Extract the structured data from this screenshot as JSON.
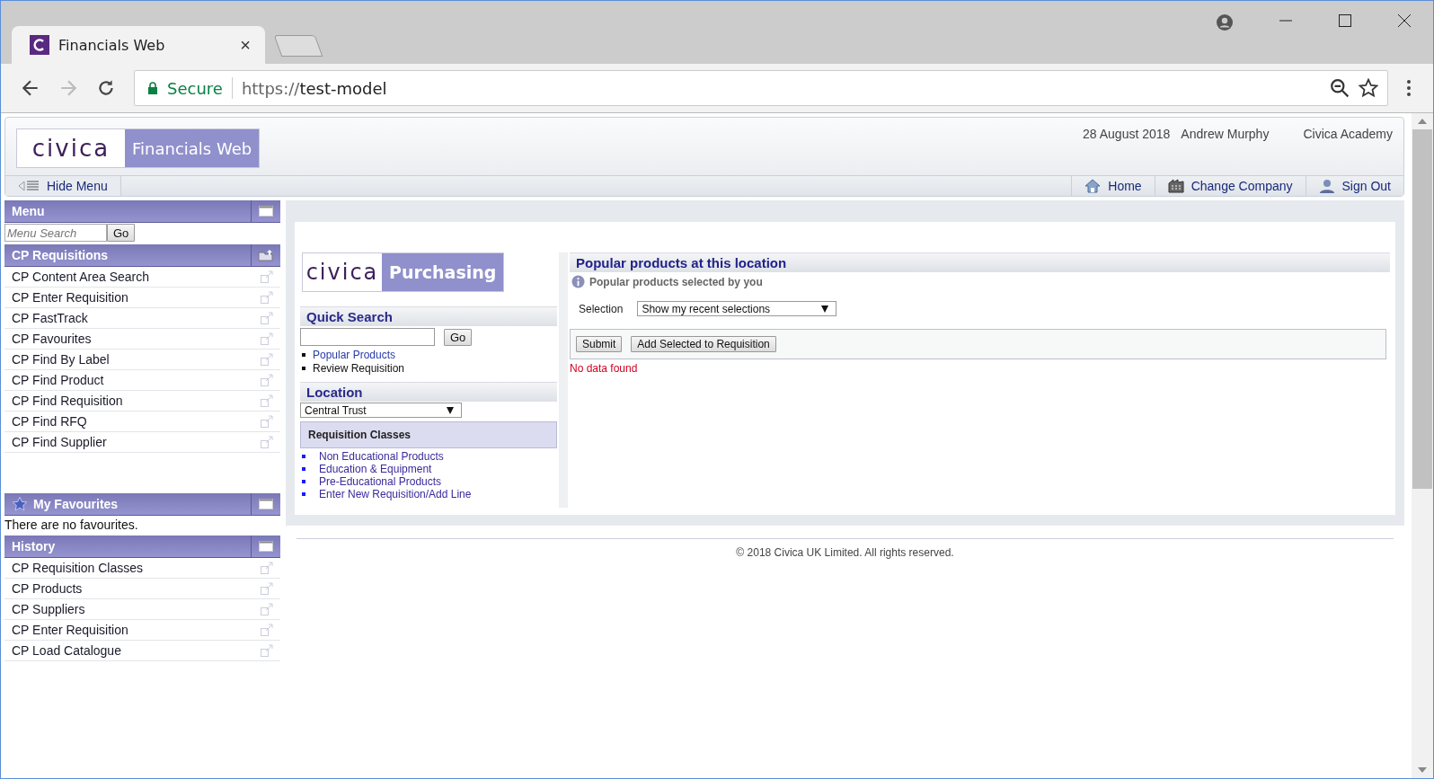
{
  "browser": {
    "tab_title": "Financials Web",
    "tab_close": "×",
    "secure_label": "Secure",
    "url_scheme": "https://",
    "url_host": "test-model"
  },
  "header": {
    "logo_text": "civica",
    "product": "Financials Web",
    "date": "28 August 2018",
    "user": "Andrew Murphy",
    "organisation": "Civica Academy"
  },
  "nav": {
    "hide_menu": "Hide Menu",
    "links": [
      {
        "kind": "home",
        "label": "Home"
      },
      {
        "kind": "company",
        "label": "Change Company"
      },
      {
        "kind": "signout",
        "label": "Sign Out"
      }
    ]
  },
  "sidebar": {
    "menu_title": "Menu",
    "search_placeholder": "Menu Search",
    "search_button": "Go",
    "sections": [
      {
        "kind": "list",
        "title": "CP Requisitions",
        "items": [
          "CP Content Area Search",
          "CP Enter Requisition",
          "CP FastTrack",
          "CP Favourites",
          "CP Find By Label",
          "CP Find Product",
          "CP Find Requisition",
          "CP Find RFQ",
          "CP Find Supplier"
        ]
      },
      {
        "kind": "favourites",
        "title": "My Favourites",
        "empty_text": "There are no favourites."
      },
      {
        "kind": "list",
        "title": "History",
        "items": [
          "CP Requisition Classes",
          "CP Products",
          "CP Suppliers",
          "CP Enter Requisition",
          "CP Load Catalogue"
        ]
      }
    ]
  },
  "purchasing": {
    "logo_text": "civica",
    "product": "Purchasing",
    "quick_search": {
      "title": "Quick Search",
      "button": "Go",
      "links": [
        {
          "kind": "link",
          "label": "Popular Products"
        },
        {
          "kind": "text",
          "label": "Review Requisition"
        }
      ]
    },
    "location": {
      "title": "Location",
      "value": "Central Trust"
    },
    "requisition_classes": {
      "title": "Requisition Classes",
      "items": [
        "Non Educational Products",
        "Education & Equipment",
        "Pre-Educational Products",
        "Enter New Requisition/Add Line"
      ]
    }
  },
  "popular": {
    "title": "Popular products at this location",
    "info": "Popular products selected by you",
    "selection_label": "Selection",
    "selection_value": "Show my recent selections",
    "buttons": [
      "Submit",
      "Add Selected to Requisition"
    ],
    "message": "No data found"
  },
  "footer": "© 2018 Civica UK Limited. All rights reserved."
}
